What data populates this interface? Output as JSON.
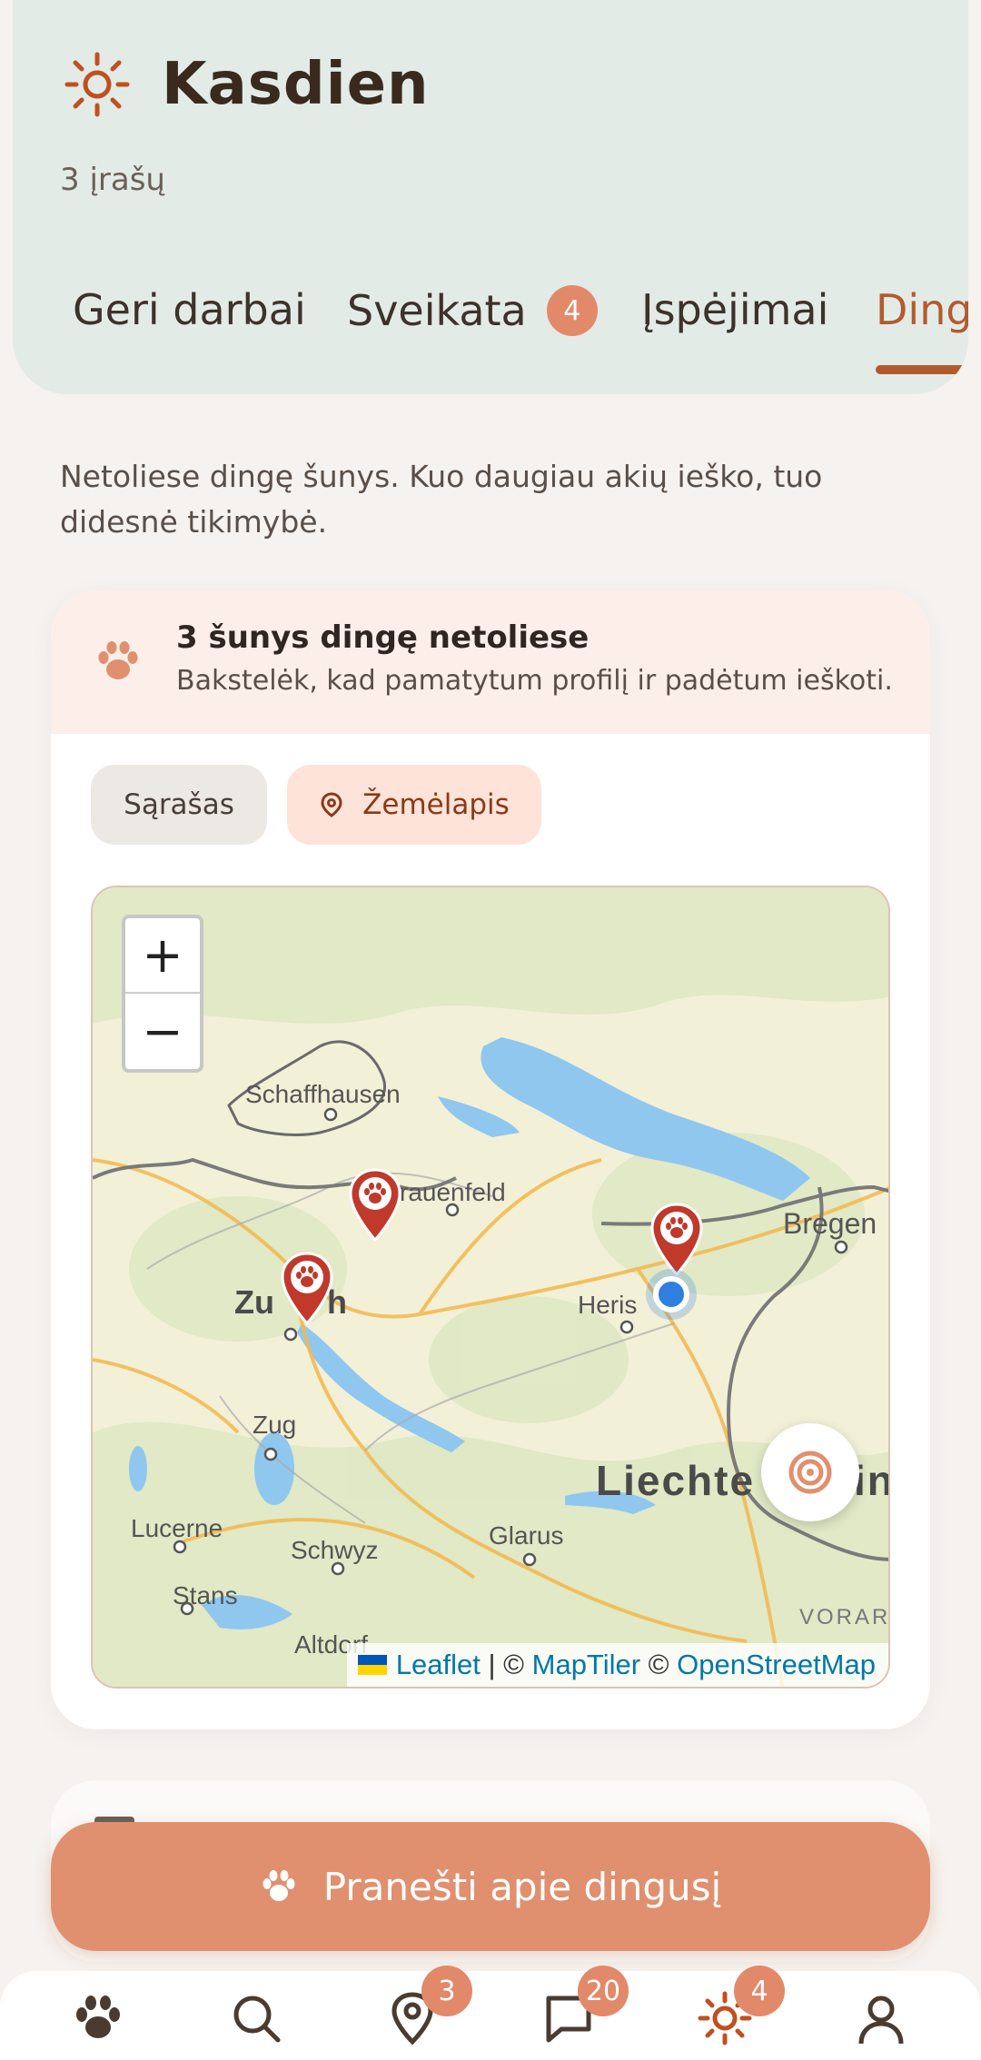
{
  "header": {
    "title": "Kasdien",
    "subtitle": "3 įrašų",
    "tabs": [
      {
        "label": "Geri darbai"
      },
      {
        "label": "Sveikata",
        "badge": "4"
      },
      {
        "label": "Įspėjimai"
      },
      {
        "label": "Ding",
        "active": true
      }
    ]
  },
  "intro_text": "Netoliese dingę šunys. Kuo daugiau akių ieško, tuo didesnė tikimybė.",
  "lost_dogs_card": {
    "banner_title": "3 šunys dingę netoliese",
    "banner_subtitle": "Bakstelėk, kad pamatytum profilį ir padėtum ieškoti.",
    "view_toggle": {
      "list_label": "Sąrašas",
      "map_label": "Žemėlapis",
      "selected": "map"
    },
    "map": {
      "zoom_in": "+",
      "zoom_out": "−",
      "place_labels": [
        "Schaffhausen",
        "Frauenfeld",
        "Bregenz",
        "Zurich",
        "Herisau",
        "Zug",
        "Liechtenstein",
        "Lucerne",
        "Schwyz",
        "Glarus",
        "Stans",
        "Altdorf",
        "VORAR"
      ],
      "visible_place_text": {
        "schaffhausen": "Schaffhausen",
        "frauenfeld": "rauenfeld",
        "bregenz": "Bregen",
        "zurich_a": "Zu",
        "zurich_b": "h",
        "herisau": "Heris",
        "zug": "Zug",
        "liechtenstein_a": "Liechte",
        "liechtenstein_b": "in",
        "lucerne": "Lucerne",
        "schwyz": "Schwyz",
        "glarus": "Glarus",
        "stans": "Stans",
        "altdorf": "Altdorf",
        "vorarlberg": "VORAR"
      },
      "lost_dog_pins": 3,
      "attribution": {
        "leaflet": "Leaflet",
        "sep1": " | © ",
        "maptiler": "MapTiler",
        "sep2": " © ",
        "osm": "OpenStreetMap"
      }
    }
  },
  "report_button": {
    "label": "Pranešti apie dingusį"
  },
  "bottom_nav": {
    "items": [
      {
        "icon": "paw-icon"
      },
      {
        "icon": "search-icon"
      },
      {
        "icon": "map-pin-icon",
        "badge": "3"
      },
      {
        "icon": "chat-icon",
        "badge": "20"
      },
      {
        "icon": "sun-icon",
        "badge": "4"
      },
      {
        "icon": "profile-icon"
      }
    ]
  },
  "colors": {
    "accent": "#e0906e",
    "accent_dark": "#b05a2f",
    "pin": "#c0392b",
    "header_bg": "#e3ebe7"
  }
}
